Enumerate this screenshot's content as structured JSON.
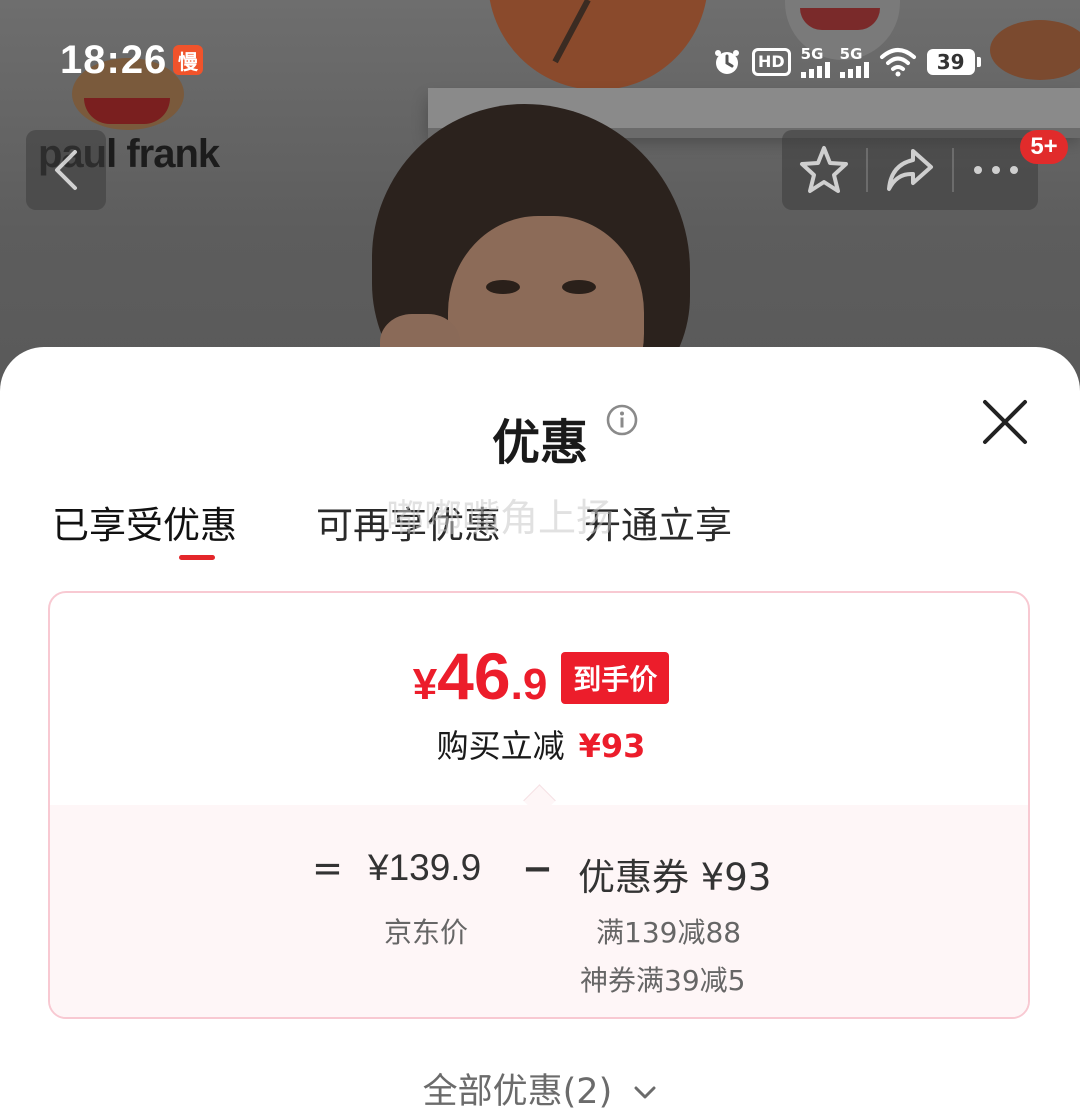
{
  "status_bar": {
    "time": "18:26",
    "slow_badge": "慢",
    "hd_label": "HD",
    "sim1_label": "5G",
    "sim2_label": "5G",
    "battery_level": "39"
  },
  "photo": {
    "brand_text": "paul frank"
  },
  "nav": {
    "cart_badge": "5+"
  },
  "sheet": {
    "title": "优惠",
    "tabs": [
      {
        "label": "已享受优惠",
        "active": true
      },
      {
        "label": "可再享优惠",
        "active": false
      },
      {
        "label": "开通立享",
        "active": false
      }
    ],
    "hint_overlay": "嘟嘟嘴角上扬",
    "final_price": {
      "currency": "¥",
      "integer": "46",
      "decimal": ".9"
    },
    "final_price_tag": "到手价",
    "saving_label": "购买立减",
    "saving_amount": "¥93",
    "breakdown": {
      "equals": "=",
      "base_price": "¥139.9",
      "base_label": "京东价",
      "minus": "−",
      "coupon": "优惠券 ¥93",
      "coupon_rules": [
        "满139减88",
        "神券满39减5"
      ]
    },
    "all_offers": "全部优惠(2)"
  },
  "colors": {
    "accent_red": "#ec1d2b",
    "card_border": "#f8c9d2",
    "breakdown_bg": "#fef6f7"
  }
}
